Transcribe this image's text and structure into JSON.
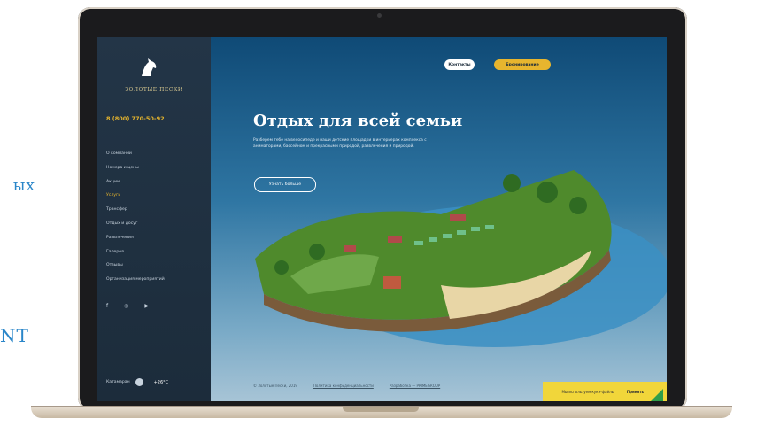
{
  "background_text": [
    "ых",
    "NT"
  ],
  "site": {
    "brand": "ЗОЛОТЫЕ ПЕСКИ",
    "phone": "8 (800) 770-50-92",
    "nav": [
      "О компании",
      "Номера и цены",
      "Акции",
      "Услуги",
      "Трансфер",
      "Отдых и досуг",
      "Развлечения",
      "Галерея",
      "Отзывы",
      "Организация мероприятий"
    ],
    "active_nav_index": 3,
    "socials": [
      "f",
      "◎",
      "▶"
    ],
    "weather_label": "Катамаран",
    "temperature": "+26°C"
  },
  "header": {
    "lang_button": "Контакты",
    "book_button": "Бронирование"
  },
  "hero": {
    "title": "Отдых для всей семьи",
    "description": "Разберем тебе на велосипеде и наши детские площадки в интерьерах комплекса с аниматорами, бассейном и прекрасными природой, развлечения и природой.",
    "more_button": "Узнать больше"
  },
  "footer": {
    "copyright": "© Золотые Пески, 2019",
    "privacy": "Политика конфиденциальности",
    "developer": "Разработка — PRIMEGROUP"
  },
  "cookie": {
    "text": "Мы используем куки-файлы",
    "ok": "Принять"
  },
  "colors": {
    "accent": "#e7b52e",
    "sidebar": "#233547",
    "water": "#2f76a3"
  }
}
